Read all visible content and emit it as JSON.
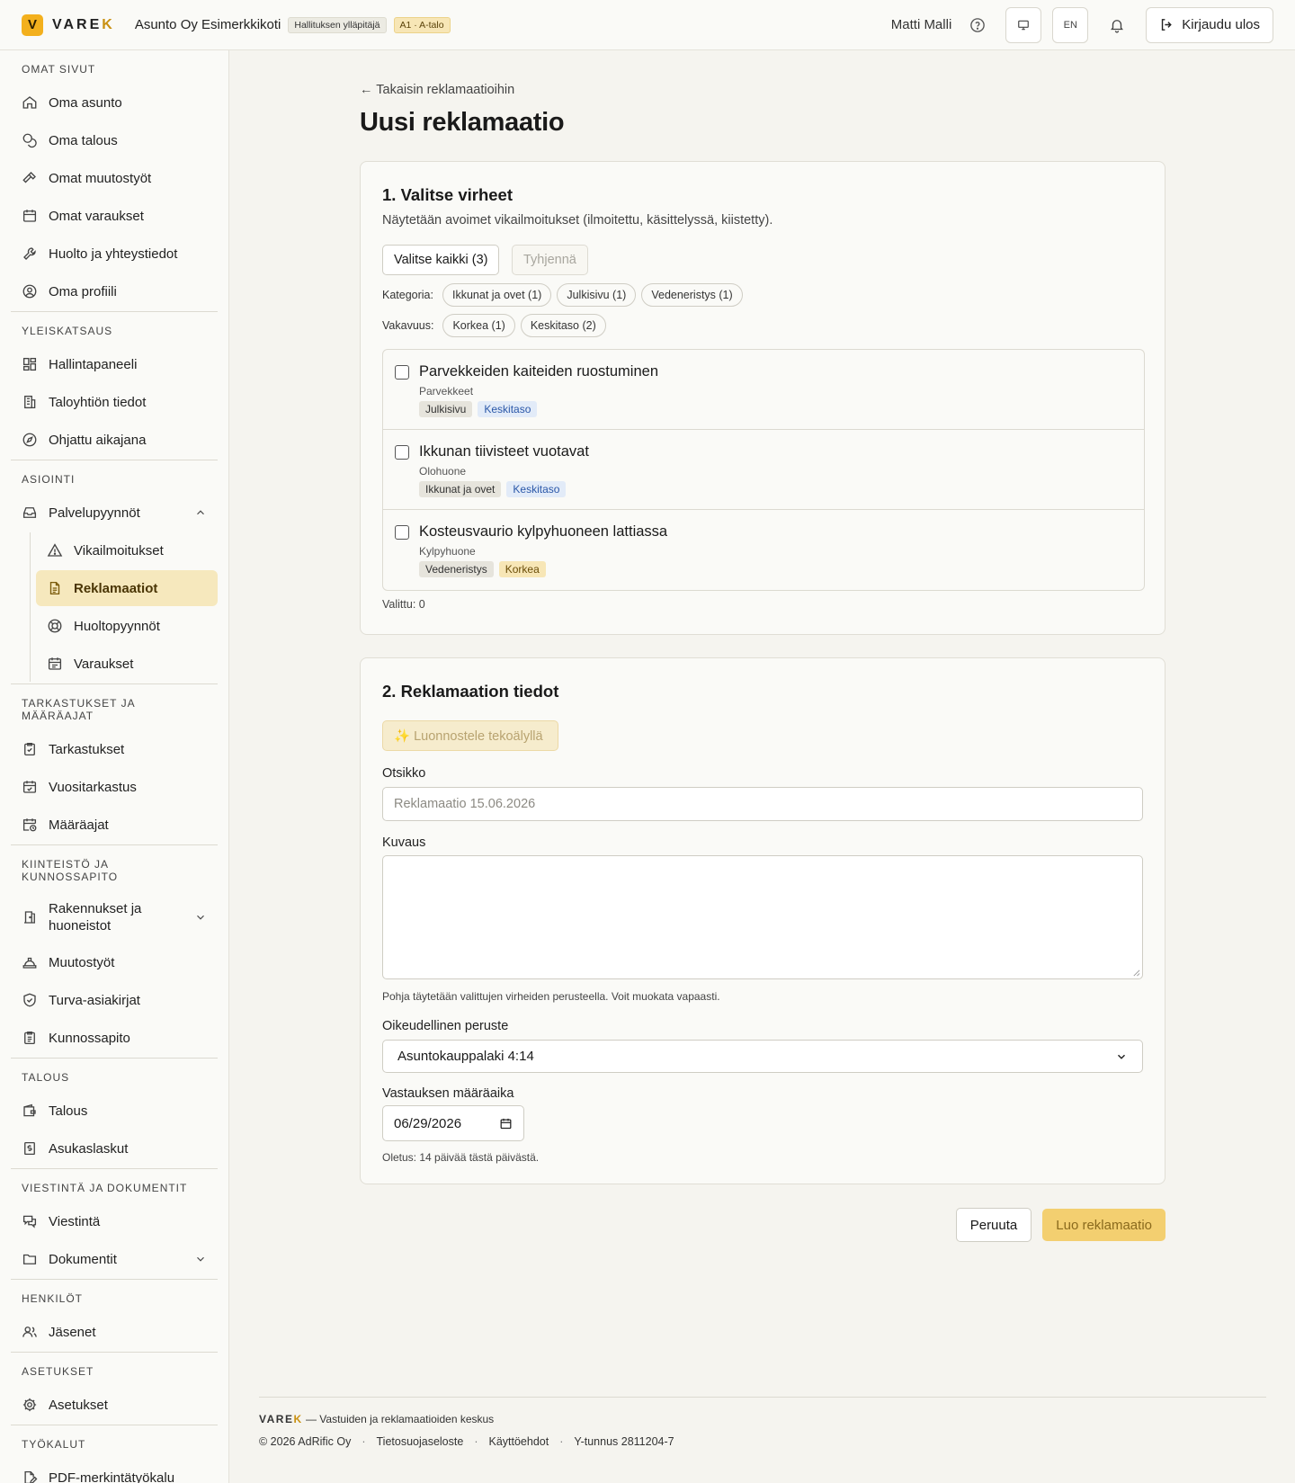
{
  "header": {
    "logo_letter": "V",
    "logo_text_main": "VARE",
    "logo_text_accent": "K",
    "org_name": "Asunto Oy Esimerkkikoti",
    "role_badge": "Hallituksen ylläpitäjä",
    "unit_badge": "A1 · A-talo",
    "user_name": "Matti Malli",
    "lang": "EN",
    "logout_label": "Kirjaudu ulos",
    "accent_color": "#f3b01d"
  },
  "sidebar": {
    "sections": [
      {
        "title": "Omat sivut",
        "items": [
          "Oma asunto",
          "Oma talous",
          "Omat muutostyöt",
          "Omat varaukset",
          "Huolto ja yhteystiedot",
          "Oma profiili"
        ]
      },
      {
        "title": "Yleiskatsaus",
        "items": [
          "Hallintapaneeli",
          "Taloyhtiön tiedot",
          "Ohjattu aikajana"
        ]
      },
      {
        "title": "Asiointi",
        "items": [
          "Palvelupyynnöt"
        ],
        "subitems": [
          "Vikailmoitukset",
          "Reklamaatiot",
          "Huoltopyynnöt",
          "Varaukset"
        ],
        "active": "Reklamaatiot"
      },
      {
        "title": "Tarkastukset ja määräajat",
        "items": [
          "Tarkastukset",
          "Vuositarkastus",
          "Määräajat"
        ]
      },
      {
        "title": "Kiinteistö ja kunnossapito",
        "items": [
          "Rakennukset ja huoneistot",
          "Muutostyöt",
          "Turva-asiakirjat",
          "Kunnossapito"
        ]
      },
      {
        "title": "Talous",
        "items": [
          "Talous",
          "Asukaslaskut"
        ]
      },
      {
        "title": "Viestintä ja dokumentit",
        "items": [
          "Viestintä",
          "Dokumentit"
        ]
      },
      {
        "title": "Henkilöt",
        "items": [
          "Jäsenet"
        ]
      },
      {
        "title": "Asetukset",
        "items": [
          "Asetukset"
        ]
      },
      {
        "title": "Työkalut",
        "items": [
          "PDF-merkintätyökalu"
        ]
      }
    ]
  },
  "page": {
    "back_link": "← Takaisin reklamaatioihin",
    "title": "Uusi reklamaatio"
  },
  "step1": {
    "title": "1. Valitse virheet",
    "subtitle": "Näytetään avoimet vikailmoitukset (ilmoitettu, käsittelyssä, kiistetty).",
    "select_all": "Valitse kaikki (3)",
    "clear": "Tyhjennä",
    "category_label": "Kategoria:",
    "categories": [
      "Ikkunat ja ovet (1)",
      "Julkisivu (1)",
      "Vedeneristys (1)"
    ],
    "severity_label": "Vakavuus:",
    "severities": [
      "Korkea (1)",
      "Keskitaso (2)"
    ],
    "defects": [
      {
        "title": "Parvekkeiden kaiteiden ruostuminen",
        "location": "Parvekkeet",
        "category": "Julkisivu",
        "severity": "Keskitaso",
        "severity_kind": "medium",
        "checked": false
      },
      {
        "title": "Ikkunan tiivisteet vuotavat",
        "location": "Olohuone",
        "category": "Ikkunat ja ovet",
        "severity": "Keskitaso",
        "severity_kind": "medium",
        "checked": false
      },
      {
        "title": "Kosteusvaurio kylpyhuoneen lattiassa",
        "location": "Kylpyhuone",
        "category": "Vedeneristys",
        "severity": "Korkea",
        "severity_kind": "high",
        "checked": false
      }
    ],
    "selected_count": "Valittu: 0"
  },
  "step2": {
    "title": "2. Reklamaation tiedot",
    "ai_draft": "✨ Luonnostele tekoälyllä",
    "title_label": "Otsikko",
    "title_placeholder": "Reklamaatio 15.06.2026",
    "desc_label": "Kuvaus",
    "desc_value": "",
    "desc_hint": "Pohja täytetään valittujen virheiden perusteella. Voit muokata vapaasti.",
    "legal_label": "Oikeudellinen peruste",
    "legal_value": "Asuntokauppalaki 4:14",
    "deadline_label": "Vastauksen määräaika",
    "deadline_value": "06/29/2026",
    "deadline_hint": "Oletus: 14 päivää tästä päivästä."
  },
  "actions": {
    "cancel": "Peruuta",
    "submit": "Luo reklamaatio"
  },
  "footer": {
    "brand_main": "VARE",
    "brand_accent": "K",
    "tagline": " — Vastuiden ja reklamaatioiden keskus",
    "copyright": "© 2026 AdRific Oy",
    "privacy": "Tietosuojaseloste",
    "terms": "Käyttöehdot",
    "business_id": "Y-tunnus 2811204-7"
  }
}
